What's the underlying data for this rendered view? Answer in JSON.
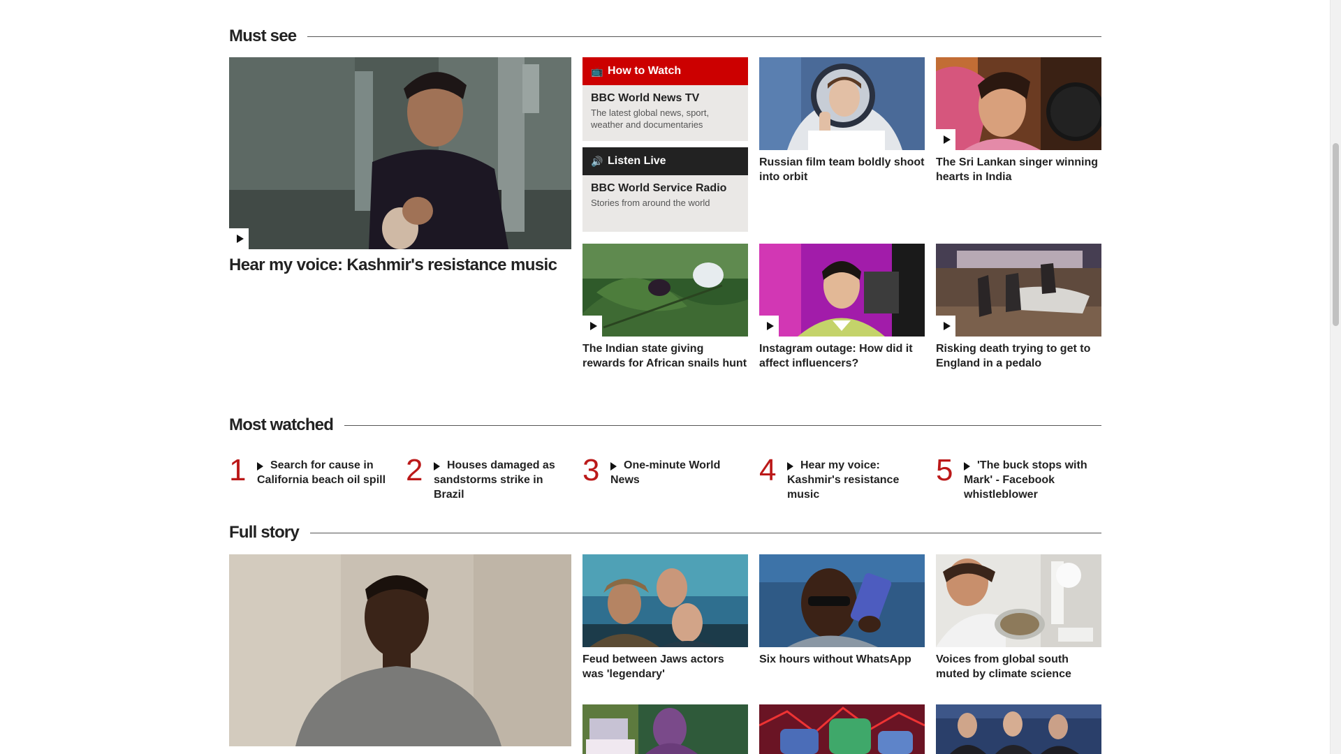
{
  "must_see": {
    "heading": "Must see",
    "hero": {
      "title": "Hear my voice: Kashmir's resistance music",
      "has_video": true
    },
    "how_to_watch": {
      "label": "How to Watch",
      "icon": "tv-icon",
      "name": "BBC World News TV",
      "description": "The latest global news, sport, weather and documentaries",
      "color": "#cc0000"
    },
    "listen_live": {
      "label": "Listen Live",
      "icon": "speaker-icon",
      "name": "BBC World Service Radio",
      "description": "Stories from around the world",
      "color": "#222222"
    },
    "cards": [
      {
        "title": "Russian film team boldly shoot into orbit",
        "has_video": false
      },
      {
        "title": "The Sri Lankan singer winning hearts in India",
        "has_video": true
      },
      {
        "title": "The Indian state giving rewards for African snails hunt",
        "has_video": true
      },
      {
        "title": "Instagram outage: How did it affect influencers?",
        "has_video": true
      },
      {
        "title": "Risking death trying to get to England in a pedalo",
        "has_video": true
      }
    ]
  },
  "most_watched": {
    "heading": "Most watched",
    "items": [
      {
        "rank": "1",
        "title": "Search for cause in California beach oil spill"
      },
      {
        "rank": "2",
        "title": "Houses damaged as sandstorms strike in Brazil"
      },
      {
        "rank": "3",
        "title": "One-minute World News"
      },
      {
        "rank": "4",
        "title": "Hear my voice: Kashmir's resistance music"
      },
      {
        "rank": "5",
        "title": "'The buck stops with Mark' - Facebook whistleblower"
      }
    ]
  },
  "full_story": {
    "heading": "Full story",
    "cards": [
      {
        "title": "Feud between Jaws actors was 'legendary'"
      },
      {
        "title": "Six hours without WhatsApp"
      },
      {
        "title": "Voices from global south muted by climate science"
      }
    ]
  },
  "colors": {
    "rank": "#bb1919",
    "promo_background": "#eae8e6"
  }
}
